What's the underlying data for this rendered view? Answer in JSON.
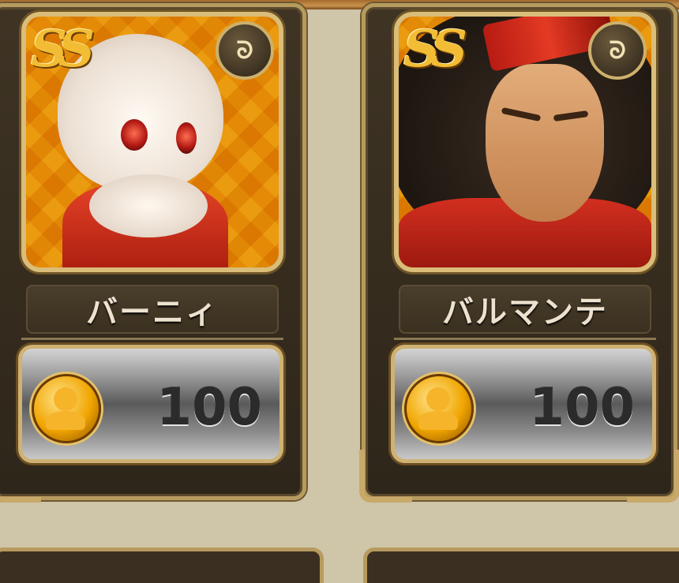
{
  "cards": [
    {
      "name": "バーニィ",
      "cost": "100",
      "rank_badge": "SS",
      "element_icon": "wind-icon",
      "currency_icon": "ally-point-icon"
    },
    {
      "name": "バルマンテ",
      "cost": "100",
      "rank_badge": "SS",
      "element_icon": "wind-icon",
      "currency_icon": "ally-point-icon"
    }
  ],
  "colors": {
    "background": "#cfc5a9",
    "card_frame": "#b79b5e",
    "portrait_bg": "#f0b51e"
  }
}
